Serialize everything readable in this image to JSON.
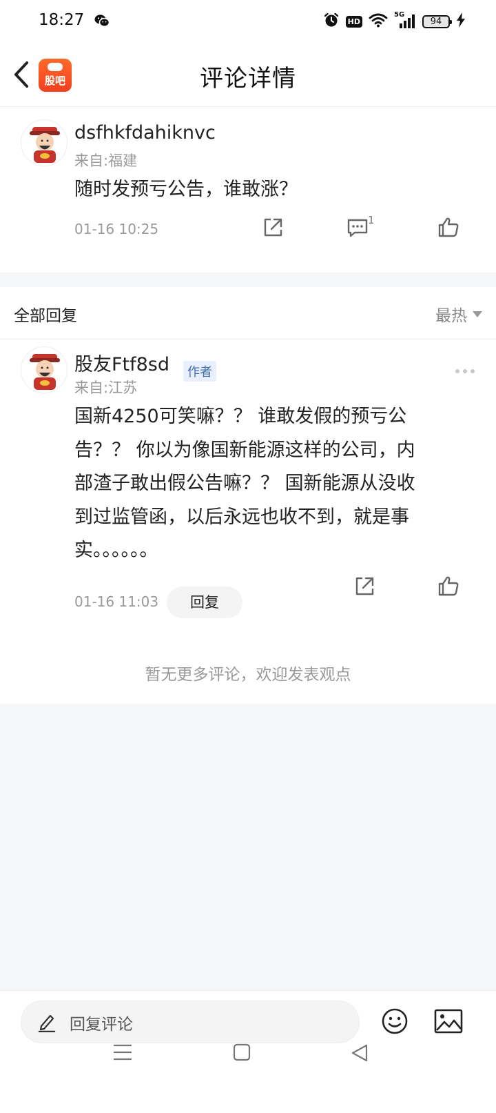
{
  "status_bar": {
    "time": "18:27",
    "hd": "HD",
    "network": "5G",
    "battery": "94"
  },
  "header": {
    "title": "评论详情",
    "app_logo_text": "股吧"
  },
  "main_comment": {
    "username": "dsfhkfdahiknvc",
    "location": "来自:福建",
    "text": "随时发预亏公告，谁敢涨？",
    "timestamp": "01-16 10:25",
    "reply_count": "1"
  },
  "replies_section": {
    "title": "全部回复",
    "sort_label": "最热"
  },
  "reply": {
    "username": "股友Ftf8sd",
    "badge": "作者",
    "location": "来自:江苏",
    "text_lines": [
      "国新4250可笑嘛？？ 谁敢发假的预亏公",
      "告？？ 你以为像国新能源这样的公司，内",
      "部渣子敢出假公告嘛？？ 国新能源从没收",
      "到过监管函，以后永远也收不到，就是事",
      "实。。。。。。"
    ],
    "timestamp": "01-16 11:03",
    "reply_button": "回复"
  },
  "footer_message": "暂无更多评论，欢迎发表观点",
  "bottom_bar": {
    "input_label": "回复评论"
  },
  "colors": {
    "brand_orange": "#f0401e",
    "author_badge_text": "#3f6fb3",
    "background": "#f5f6f8"
  },
  "icons": [
    "wechat-icon",
    "alarm-icon",
    "wifi-icon",
    "signal-icon",
    "charging-icon",
    "back-icon",
    "share-icon",
    "comment-icon",
    "like-icon",
    "more-icon",
    "pencil-icon",
    "emoji-icon",
    "image-icon",
    "menu-nav-icon",
    "home-nav-icon",
    "back-nav-icon"
  ]
}
